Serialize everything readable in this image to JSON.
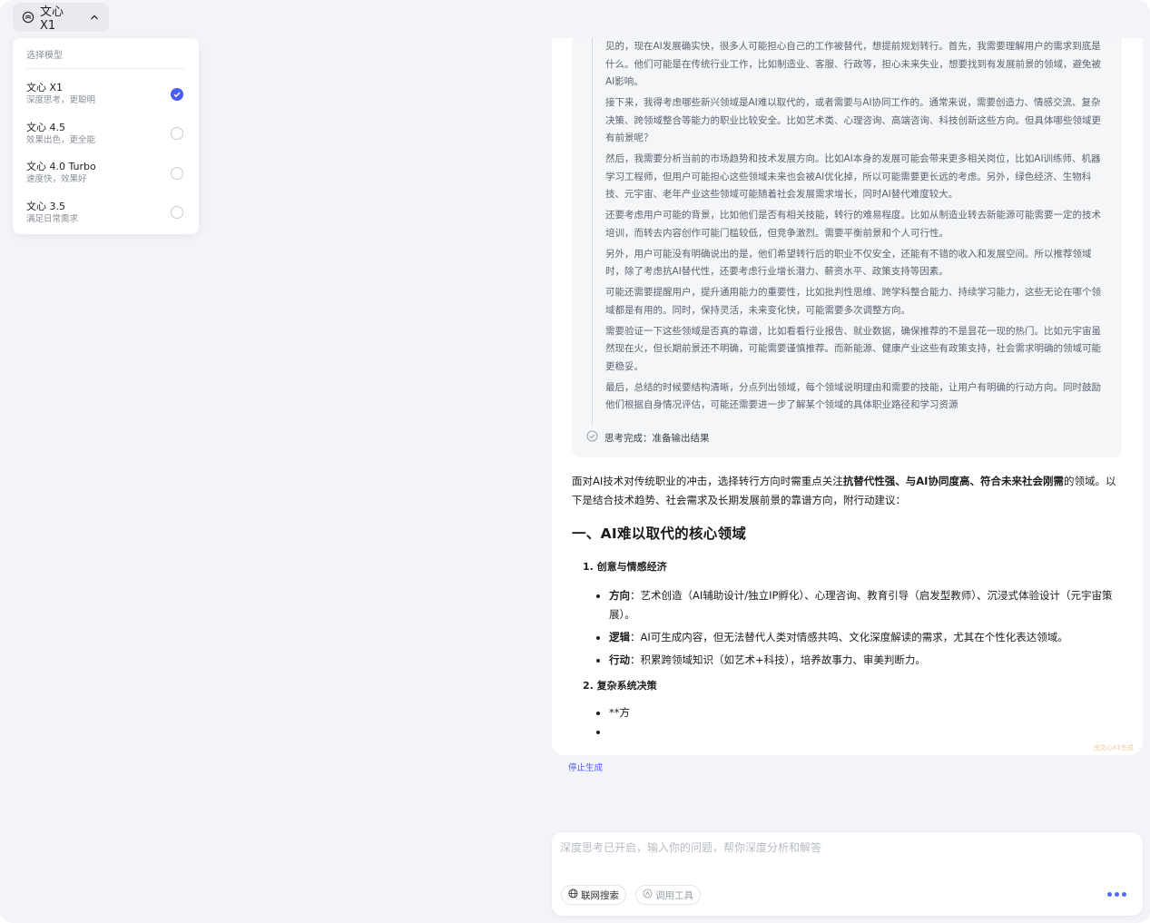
{
  "model_selector": {
    "current": "文心 X1",
    "dropdown_title": "选择模型",
    "options": [
      {
        "name": "文心 X1",
        "desc": "深度思考，更聪明",
        "selected": true
      },
      {
        "name": "文心 4.5",
        "desc": "效果出色，更全能",
        "selected": false
      },
      {
        "name": "文心 4.0 Turbo",
        "desc": "速度快，效果好",
        "selected": false
      },
      {
        "name": "文心 3.5",
        "desc": "满足日常需求",
        "selected": false
      }
    ]
  },
  "thinking": {
    "paragraphs": [
      "见的，现在AI发展确实快，很多人可能担心自己的工作被替代，想提前规划转行。首先，我需要理解用户的需求到底是什么。他们可能是在传统行业工作，比如制造业、客服、行政等，担心未来失业，想要找到有发展前景的领域，避免被AI影响。",
      "接下来，我得考虑哪些新兴领域是AI难以取代的，或者需要与AI协同工作的。通常来说，需要创造力、情感交流、复杂决策、跨领域整合等能力的职业比较安全。比如艺术类、心理咨询、高端咨询、科技创新这些方向。但具体哪些领域更有前景呢？",
      "然后，我需要分析当前的市场趋势和技术发展方向。比如AI本身的发展可能会带来更多相关岗位，比如AI训练师、机器学习工程师，但用户可能担心这些领域未来也会被AI优化掉，所以可能需要更长远的考虑。另外，绿色经济、生物科技、元宇宙、老年产业这些领域可能随着社会发展需求增长，同时AI替代难度较大。",
      "还要考虑用户可能的背景，比如他们是否有相关技能，转行的难易程度。比如从制造业转去新能源可能需要一定的技术培训，而转去内容创作可能门槛较低，但竞争激烈。需要平衡前景和个人可行性。",
      "另外，用户可能没有明确说出的是，他们希望转行后的职业不仅安全，还能有不错的收入和发展空间。所以推荐领域时，除了考虑抗AI替代性，还要考虑行业增长潜力、薪资水平、政策支持等因素。",
      "可能还需要提醒用户，提升通用能力的重要性，比如批判性思维、跨学科整合能力、持续学习能力，这些无论在哪个领域都是有用的。同时，保持灵活，未来变化快，可能需要多次调整方向。",
      "需要验证一下这些领域是否真的靠谱，比如看看行业报告、就业数据，确保推荐的不是昙花一现的热门。比如元宇宙虽然现在火，但长期前景还不明确，可能需要谨慎推荐。而新能源、健康产业这些有政策支持，社会需求明确的领域可能更稳妥。",
      "最后，总结的时候要结构清晰，分点列出领域，每个领域说明理由和需要的技能，让用户有明确的行动方向。同时鼓励他们根据自身情况评估，可能还需要进一步了解某个领域的具体职业路径和学习资源"
    ],
    "done_label": "思考完成：准备输出结果"
  },
  "answer": {
    "intro_1": "面对AI技术对传统职业的冲击，选择转行方向时需重点关注",
    "intro_bold": "抗替代性强、与AI协同度高、符合未来社会刚需",
    "intro_2": "的领域。以下是结合技术趋势、社会需求及长期发展前景的靠谱方向，附行动建议：",
    "heading": "一、AI难以取代的核心领域",
    "item1": "1. 创意与情感经济",
    "bullets": [
      {
        "label": "方向",
        "text": "：艺术创造（AI辅助设计/独立IP孵化）、心理咨询、教育引导（启发型教师）、沉浸式体验设计（元宇宙策展）。"
      },
      {
        "label": "逻辑",
        "text": "：AI可生成内容，但无法替代人类对情感共鸣、文化深度解读的需求，尤其在个性化表达领域。"
      },
      {
        "label": "行动",
        "text": "：积累跨领域知识（如艺术+科技），培养故事力、审美判断力。"
      }
    ],
    "item2": "2. 复杂系统决策",
    "partial_bullet": "**方",
    "watermark": "由文心X1生成"
  },
  "stop_label": "停止生成",
  "input": {
    "placeholder": "深度思考已开启，输入你的问题，帮你深度分析和解答",
    "web_search_label": "联网搜索",
    "tools_label": "调用工具"
  },
  "colors": {
    "accent": "#4a5cf5",
    "panel_bg": "#f3f4f7",
    "thinking_bg": "#f5f6f8"
  }
}
